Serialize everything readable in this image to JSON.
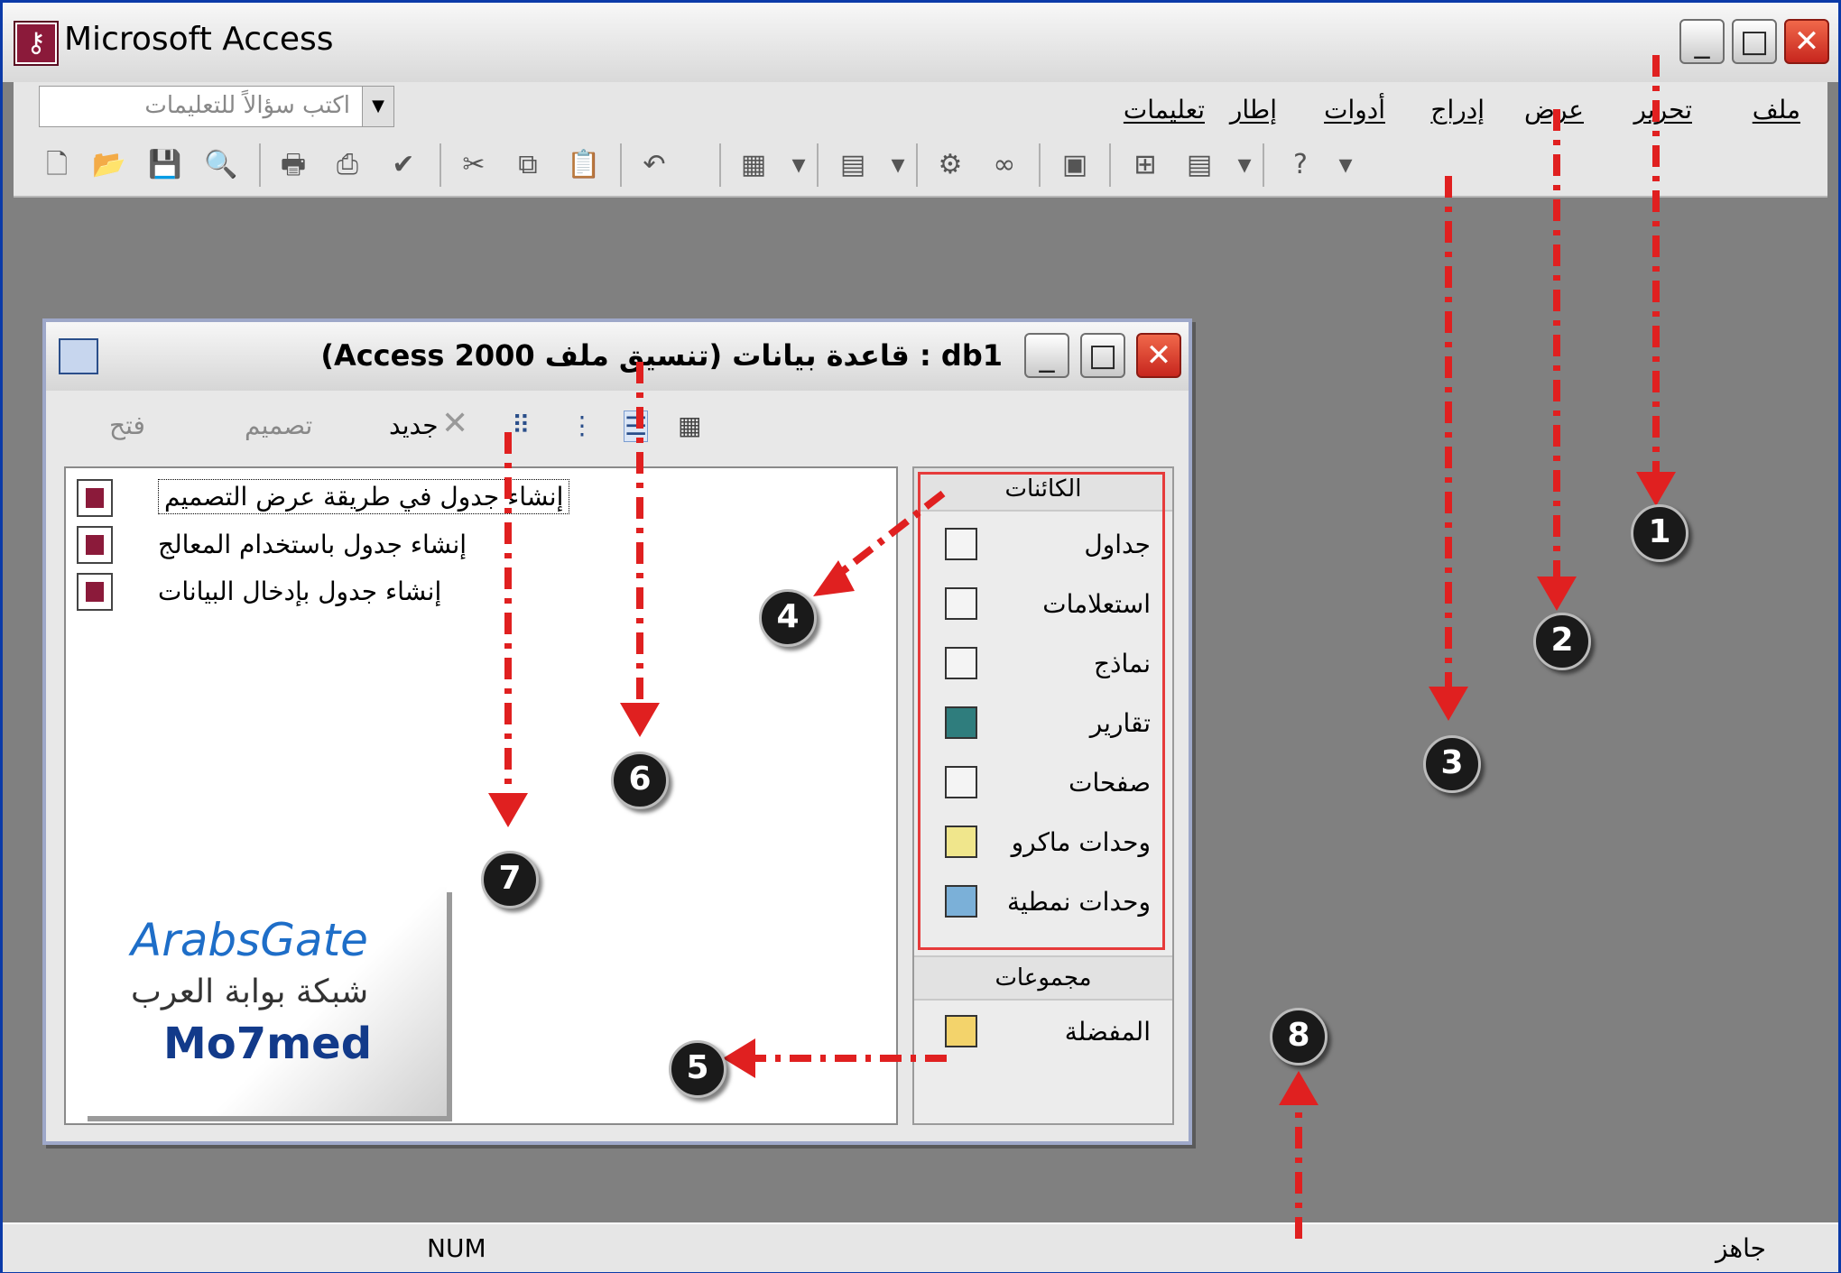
{
  "app": {
    "title": "Microsoft Access",
    "icon": "access-key-icon"
  },
  "window_controls": {
    "minimize": "_",
    "maximize": "□",
    "close": "✕"
  },
  "menu": {
    "items": [
      "ملف",
      "تحرير",
      "عرض",
      "إدراج",
      "أدوات",
      "إطار",
      "تعليمات"
    ]
  },
  "help": {
    "placeholder": "اكتب سؤالاً للتعليمات"
  },
  "status": {
    "ready": "جاهز",
    "num": "NUM"
  },
  "db_window": {
    "title": "db1 : قاعدة بيانات (تنسيق ملف Access 2000)",
    "toolbar": {
      "open": "فتح",
      "design": "تصميم",
      "new": "جديد"
    },
    "list_items": [
      "إنشاء جدول في طريقة عرض التصميم",
      "إنشاء جدول باستخدام المعالج",
      "إنشاء جدول بإدخال البيانات"
    ],
    "objects_header": "الكائنات",
    "objects": [
      "جداول",
      "استعلامات",
      "نماذج",
      "تقارير",
      "صفحات",
      "وحدات ماكرو",
      "وحدات نمطية"
    ],
    "groups_header": "مجموعات",
    "groups": [
      "المفضلة"
    ]
  },
  "logo": {
    "brand": "ArabsGate",
    "arabic": "شبكة بوابة العرب",
    "author": "Mo7med"
  },
  "callouts": [
    "1",
    "2",
    "3",
    "4",
    "5",
    "6",
    "7",
    "8"
  ],
  "colors": {
    "arrow": "#e02020",
    "selection_box": "#e63b3b",
    "desktop": "#808080"
  }
}
